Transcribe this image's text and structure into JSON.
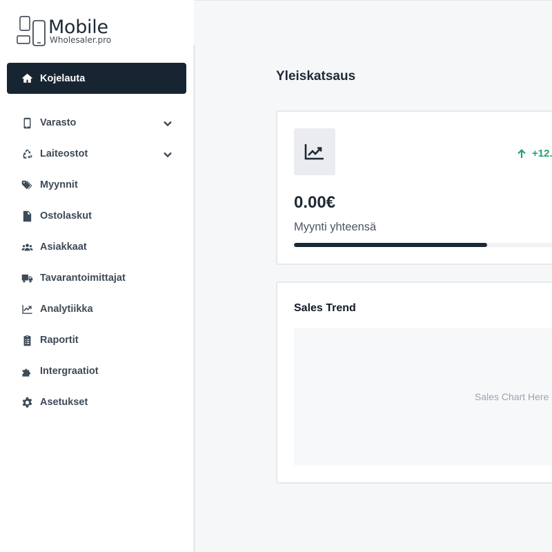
{
  "brand": {
    "name": "Mobile",
    "subtitle": "Wholesaler.pro"
  },
  "sidebar": {
    "active": {
      "label": "Kojelauta",
      "icon": "home-icon"
    },
    "items": [
      {
        "label": "Varasto",
        "icon": "smartphone-icon",
        "has_submenu": true
      },
      {
        "label": "Laiteostot",
        "icon": "recycle-icon",
        "has_submenu": true
      },
      {
        "label": "Myynnit",
        "icon": "tags-icon",
        "has_submenu": false
      },
      {
        "label": "Ostolaskut",
        "icon": "file-invoice-icon",
        "has_submenu": false
      },
      {
        "label": "Asiakkaat",
        "icon": "users-icon",
        "has_submenu": false
      },
      {
        "label": "Tavarantoimittajat",
        "icon": "truck-icon",
        "has_submenu": false
      },
      {
        "label": "Analytiikka",
        "icon": "chart-line-icon",
        "has_submenu": false
      },
      {
        "label": "Raportit",
        "icon": "clipboard-list-icon",
        "has_submenu": false
      },
      {
        "label": "Intergraatiot",
        "icon": "puzzle-piece-icon",
        "has_submenu": false
      },
      {
        "label": "Asetukset",
        "icon": "gear-icon",
        "has_submenu": false
      }
    ]
  },
  "main": {
    "title": "Yleiskatsaus",
    "kpi": {
      "icon": "chart-line-icon",
      "change": "+12.",
      "change_color": "#22a36b",
      "value": "0.00€",
      "label": "Myynti yhteensä",
      "progress": 0.71
    },
    "trend": {
      "title": "Sales Trend",
      "placeholder": "Sales Chart Here"
    }
  },
  "colors": {
    "accent": "#172532",
    "positive": "#22a36b",
    "background": "#f6f7f9"
  }
}
